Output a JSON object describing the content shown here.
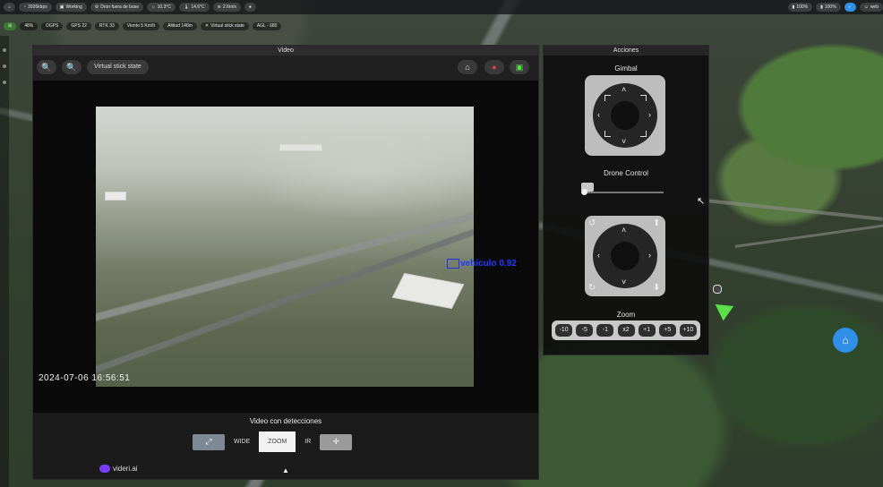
{
  "topbar": {
    "items": [
      "3926kbps",
      "Working",
      "Dron fuera de base",
      "10.3°C",
      "14.6°C",
      "2.6m/s"
    ],
    "right": [
      "100%",
      "100%",
      "web"
    ]
  },
  "status": [
    "48%",
    "DGPS",
    "GPS 22",
    "RTK 33",
    "Viento 5 Km/h",
    "Altitud 148m",
    "Virtual stick state",
    "AGL - 680"
  ],
  "video": {
    "header": "Video",
    "toolbar_state": "Virtual stick state",
    "detection": {
      "label": "vehiculo",
      "score": "0.92"
    },
    "timestamp": "2024-07-06  16:56:51",
    "footer_title": "Video con detecciones",
    "modes": {
      "wide": "WIDE",
      "zoom": "ZOOM",
      "ir": "IR"
    },
    "brand": "videri.ai"
  },
  "acciones": {
    "header": "Acciones",
    "gimbal_label": "Gimbal",
    "drone_label": "Drone Control",
    "zoom_label": "Zoom",
    "zoom_buttons": [
      "-10",
      "-5",
      "-1",
      "x2",
      "+1",
      "+5",
      "+10"
    ]
  },
  "colors": {
    "detection": "#2030ff",
    "accent": "#2f8fe8",
    "green": "#5ce04a"
  }
}
